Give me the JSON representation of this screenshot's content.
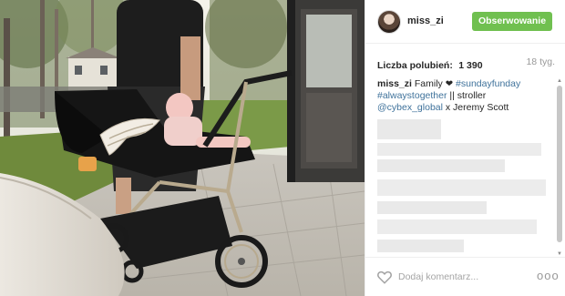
{
  "post": {
    "username": "miss_zi",
    "follow_label": "Obserwowanie",
    "likes_label": "Liczba polubień:",
    "likes_count": "1 390",
    "age": "18 tyg.",
    "caption": {
      "user": "miss_zi",
      "text1": " Family ",
      "heart": "❤",
      "tag1": " #sundayfunday",
      "tag2": "#alwaystogether",
      "text2": " || stroller",
      "mention": "@cybex_global",
      "text3": " x Jeremy Scott"
    },
    "comment_placeholder": "Dodaj komentarz...",
    "more": "ooo"
  },
  "colors": {
    "follow_button": "#70c050",
    "hashtag": "#3f729b"
  },
  "icons": {
    "like": "heart-outline-icon",
    "more": "more-options-icon",
    "scroll_up": "scroll-up-arrow-icon",
    "scroll_down": "scroll-down-arrow-icon"
  }
}
